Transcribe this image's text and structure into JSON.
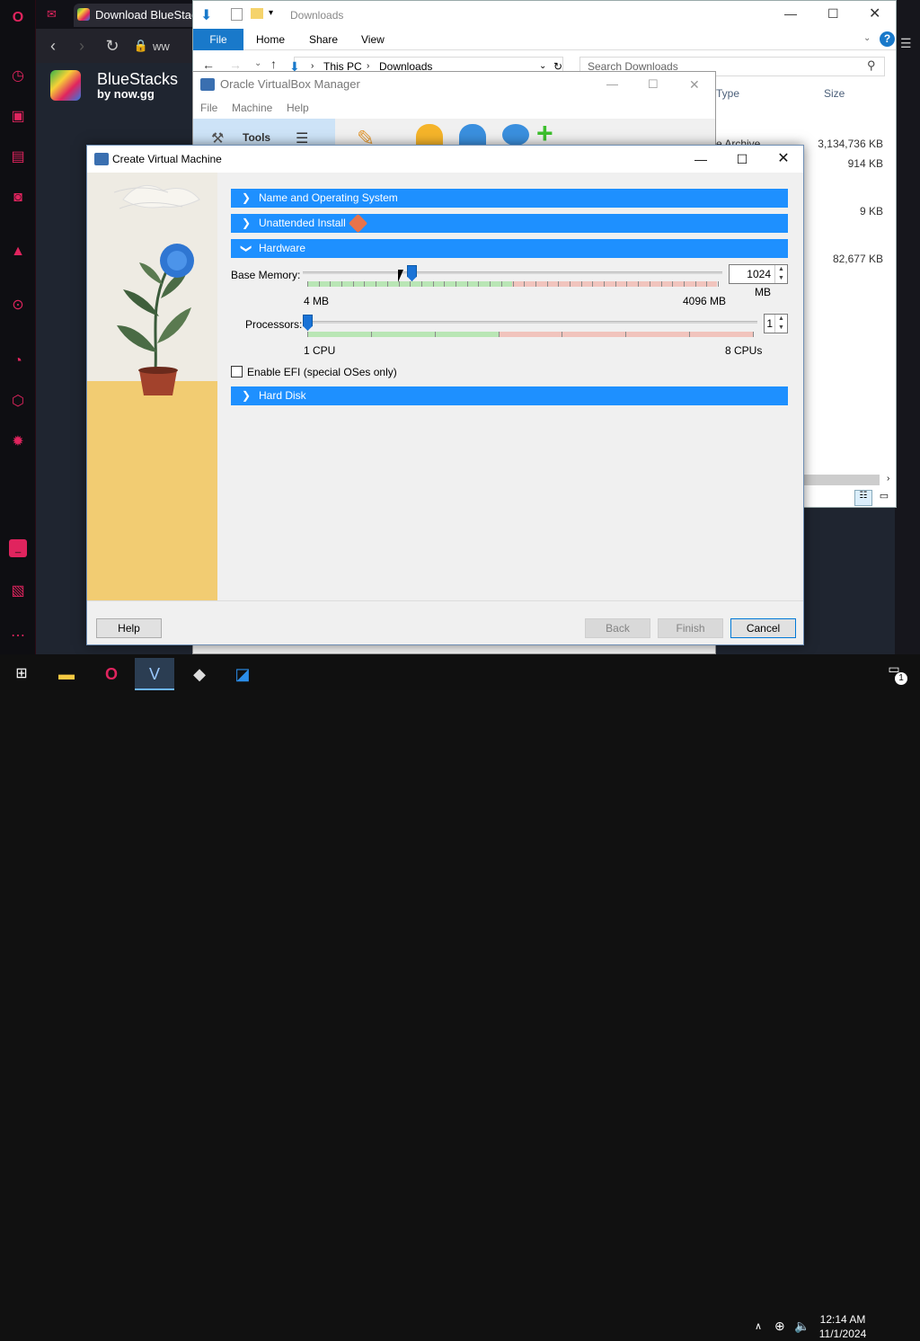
{
  "opera": {
    "tab_title": "Download BlueStacks",
    "address_partial": "ww"
  },
  "bluestacks": {
    "title": "BlueStacks",
    "subtitle": "by now.gg"
  },
  "explorer": {
    "title": "Downloads",
    "ribbon": [
      "File",
      "Home",
      "Share",
      "View"
    ],
    "address": [
      "This PC",
      "Downloads"
    ],
    "search_placeholder": "Search Downloads",
    "columns": {
      "type": "Type",
      "size": "Size"
    },
    "partial_type": "e Archive",
    "sizes": [
      "3,134,736 KB",
      "914 KB",
      "9 KB",
      "82,677 KB"
    ]
  },
  "vbox_manager": {
    "title": "Oracle VirtualBox Manager",
    "menu": [
      "File",
      "Machine",
      "Help"
    ],
    "tools_label": "Tools"
  },
  "dialog": {
    "title": "Create Virtual Machine",
    "sections": {
      "name_os": "Name and Operating System",
      "unattended": "Unattended Install",
      "hardware": "Hardware",
      "hard_disk": "Hard Disk"
    },
    "memory": {
      "label": "Base Memory:",
      "value": "1024 MB",
      "min_label": "4 MB",
      "max_label": "4096 MB",
      "level": 0.25
    },
    "processors": {
      "label": "Processors:",
      "value": "1",
      "min_label": "1 CPU",
      "max_label": "8 CPUs",
      "level": 0.0
    },
    "efi_label": "Enable EFI (special OSes only)",
    "buttons": {
      "help": "Help",
      "back": "Back",
      "finish": "Finish",
      "cancel": "Cancel"
    }
  },
  "taskbar": {
    "time": "12:14 AM",
    "date": "11/1/2024",
    "notification_count": "1"
  },
  "colors": {
    "section_blue": "#1e90ff",
    "opera_red": "#e0245e",
    "explorer_file_tab": "#1979ca"
  }
}
